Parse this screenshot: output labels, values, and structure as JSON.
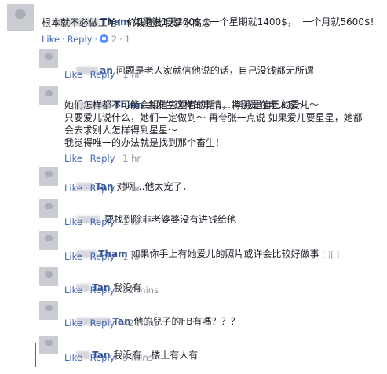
{
  "comments": [
    {
      "author": "Tham",
      "lines": [
        "如果说1天200$，一个星期就1400$，  一个月就5600$!",
        "根本就不必做工哈！价钱还比我薪水高😨"
      ],
      "actions": {
        "like": "Like",
        "reply": "Reply",
        "reactions": "2",
        "time": "1"
      }
    },
    {
      "author": "an",
      "lines": [
        "问题是老人家就信他说的话，自己没钱都无所谓"
      ],
      "actions": {
        "like": "Like",
        "reply": "Reply",
        "time": "1 hr"
      }
    },
    {
      "author": "Tham",
      "lines": [
        "会发生这样的事情，特别是在老人家～",
        "她们怎样都不可能会相信旁观者的话……毕竟是自己的爱儿～",
        "只要爱儿说什么，她们一定做到～ 再夸张一点说 如果爱儿要星星，她都",
        "会去求别人怎样得到星星～",
        "我觉得唯一的办法就是找到那个畜生！"
      ],
      "actions": {
        "like": "Like",
        "reply": "Reply",
        "time": "1 hr"
      }
    },
    {
      "author": "Tan",
      "lines": [
        "对咧…他太宠了．"
      ],
      "actions": {
        "like": "Like",
        "reply": "Reply",
        "time": "1 hr"
      }
    },
    {
      "author": "",
      "lines": [
        "要找到除非老婆婆没有进钱给他"
      ],
      "actions": {
        "like": "Like",
        "reply": "Reply",
        "time": "1 hr"
      }
    },
    {
      "author": "Tham",
      "lines": [
        "如果你手上有她爱儿的照片或许会比较好做事"
      ],
      "see_translation": "[ ][ ]",
      "actions": {
        "like": "Like",
        "reply": "Reply",
        "time": "1 hr"
      }
    },
    {
      "author": "Tan",
      "lines": [
        "我没有"
      ],
      "actions": {
        "like": "Like",
        "reply": "Reply",
        "time": "52 mins"
      }
    },
    {
      "author": "Tan",
      "lines": [
        "他的兒子的FB有嗎？？？"
      ],
      "actions": {
        "like": "Like",
        "reply": "Reply",
        "time": "42 mins"
      }
    },
    {
      "author": "Tan",
      "lines": [
        "我没有，楼上有人有"
      ],
      "actions": {
        "like": "Like",
        "reply": "Reply",
        "time": "9 mins"
      }
    }
  ],
  "separator": "·",
  "colors": {
    "author": "#365899",
    "link": "#4267b2",
    "meta": "#90949c",
    "text": "#1d2129"
  }
}
